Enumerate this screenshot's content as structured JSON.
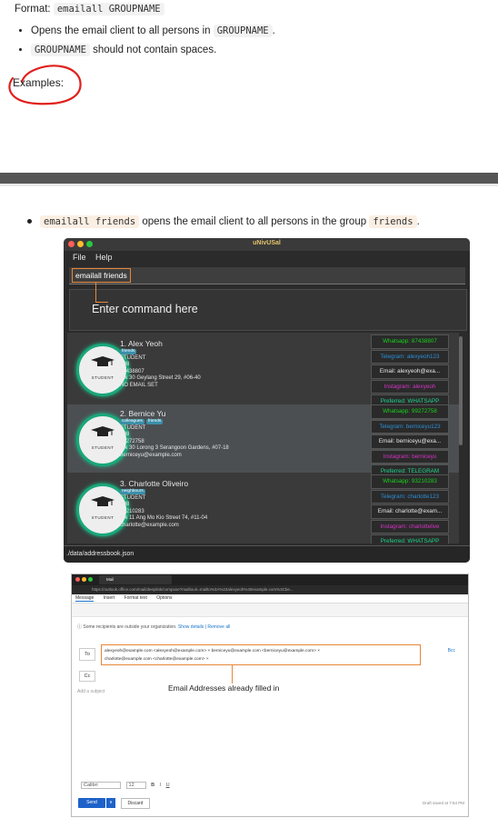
{
  "format": {
    "prefix": "Format:",
    "code": "emailall GROUPNAME"
  },
  "bullets": [
    {
      "before": "Opens the email client to all persons in ",
      "code": "GROUPNAME",
      "after": "."
    },
    {
      "before": "",
      "code": "GROUPNAME",
      "after": " should not contain spaces."
    }
  ],
  "examples_label": "Examples:",
  "example": {
    "code1": "emailall friends",
    "text1": " opens the email client to all persons in the group ",
    "code2": "friends",
    "text2": "."
  },
  "app": {
    "title": "uNivUSal",
    "menu": [
      "File",
      "Help"
    ],
    "command": "emailall friends",
    "annotation": "Enter command here",
    "status": "./data/addressbook.json",
    "avatar_label": "STUDENT",
    "persons": [
      {
        "name": "1. Alex Yeoh",
        "tags": [
          "friends"
        ],
        "role": "STUDENT",
        "room": "F08",
        "phone": "87438807",
        "address": "Blk 30 Geylang Street 29, #06-40",
        "email": "NO EMAIL SET",
        "side": [
          "Whatsapp: 87438807",
          "Telegram: alexyeoh123",
          "Email: alexyeoh@exa...",
          "Instagram: alexyeoh",
          "Preferred: WHATSAPP"
        ]
      },
      {
        "name": "2. Bernice Yu",
        "tags": [
          "colleagues",
          "friends"
        ],
        "role": "STUDENT",
        "room": "F08",
        "phone": "99272758",
        "address": "Blk 30 Lorong 3 Serangoon Gardens, #07-18",
        "email": "berniceyu@example.com",
        "side": [
          "Whatsapp: 99272758",
          "Telegram: berniceyu123",
          "Email: berniceyu@exa...",
          "Instagram: berniceyu",
          "Preferred: TELEGRAM"
        ]
      },
      {
        "name": "3. Charlotte Oliveiro",
        "tags": [
          "neighbours"
        ],
        "role": "STUDENT",
        "room": "F08",
        "phone": "93210283",
        "address": "Blk 11 Ang Mo Kio Street 74, #11-04",
        "email": "charlotte@example.com",
        "side": [
          "Whatsapp: 93210283",
          "Telegram: charlotte123",
          "Email: charlotte@exam...",
          "Instagram: charlottelive",
          "Preferred: WHATSAPP"
        ]
      }
    ],
    "side_colors": [
      "#19d11e",
      "#2b8fd6",
      "#e6e6e6",
      "#d534c6",
      "#1fd68c"
    ]
  },
  "mail": {
    "tab": "Mail",
    "url": "https://outlook.office.com/mail/deeplink/compose?mailtouri=mailto%3A%22alexyeoh%40example.com%3Cbe...",
    "ribbon": [
      "Message",
      "Insert",
      "Format text",
      "Options"
    ],
    "notice_text": "Some recipients are outside your organization.",
    "notice_links": "Show details | Remove all",
    "to": "To",
    "recipients": "alexyeoh@example.com <alexyeoh@example.com> ×   berniceyu@example.com <berniceyu@example.com> ×",
    "recipients2": "charlotte@example.com <charlotte@example.com> ×",
    "bcc": "Bcc",
    "cc": "Cc",
    "subject_placeholder": "Add a subject",
    "annotation": "Email Addresses already filled in",
    "font": "Calibri",
    "font_size": "12",
    "send": "Send",
    "discard": "Discard",
    "draft": "Draft saved at 7:54 PM"
  }
}
